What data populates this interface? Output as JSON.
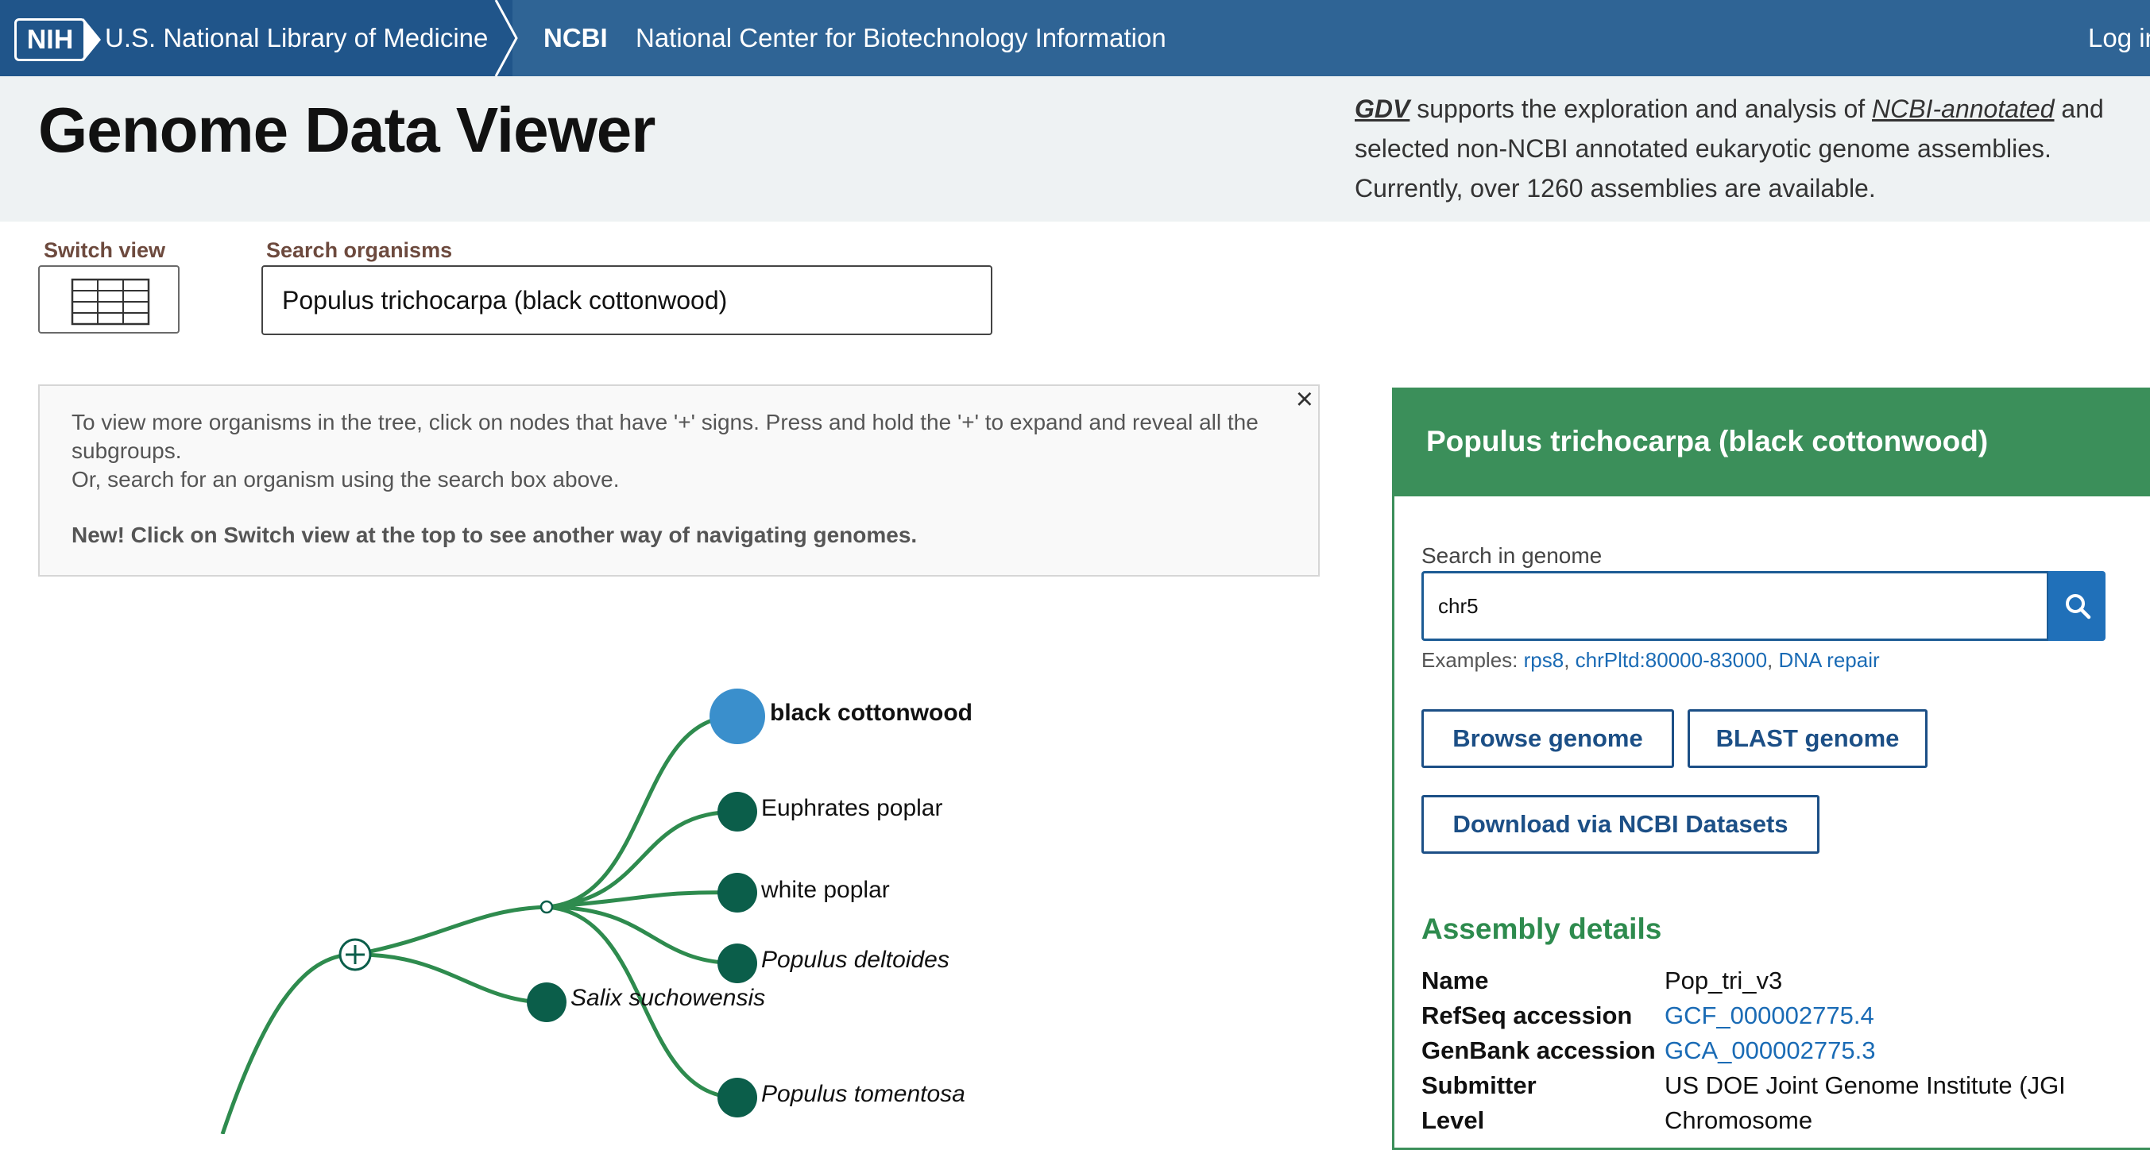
{
  "topbar": {
    "nih_badge": "NIH",
    "nih_name": "U.S. National Library of Medicine",
    "ncbi_short": "NCBI",
    "ncbi_long": "National Center for Biotechnology Information",
    "login": "Log in"
  },
  "header": {
    "title": "Genome Data Viewer",
    "intro_gdv": "GDV",
    "intro_part1": " supports the exploration and analysis of ",
    "intro_link": "NCBI-annotated",
    "intro_part2": " and selected non-NCBI annotated eukaryotic genome assemblies. Currently, over 1260 assemblies are available."
  },
  "controls": {
    "switch_view_label": "Switch view",
    "search_label": "Search organisms",
    "search_value": "Populus trichocarpa (black cottonwood)"
  },
  "info": {
    "line1": "To view more organisms in the tree, click on nodes that have '+' signs. Press and hold the '+' to expand and reveal all the subgroups.",
    "line2": "Or, search for an organism using the search box above.",
    "new_line": "New! Click on Switch view at the top to see another way of navigating genomes.",
    "close": "×"
  },
  "tree": {
    "leaves": [
      {
        "label": "black cottonwood",
        "style": "selected"
      },
      {
        "label": "Euphrates poplar",
        "style": "normal"
      },
      {
        "label": "white poplar",
        "style": "normal"
      },
      {
        "label": "Populus deltoides",
        "style": "italic"
      },
      {
        "label": "Salix suchowensis",
        "style": "italic"
      },
      {
        "label": "Populus tomentosa",
        "style": "italic"
      }
    ],
    "colors": {
      "branch": "#2e8b4e",
      "leaf": "#0b5e4a",
      "selected": "#3a8fcc"
    }
  },
  "panel": {
    "title": "Populus trichocarpa (black cottonwood)",
    "search_label": "Search in genome",
    "search_value": "chr5",
    "examples_label": "Examples: ",
    "examples": [
      "rps8",
      "chrPltd:80000-83000",
      "DNA repair"
    ],
    "buttons": {
      "browse": "Browse genome",
      "blast": "BLAST genome",
      "download": "Download via NCBI Datasets"
    },
    "assembly_title": "Assembly details",
    "details": [
      {
        "key": "Name",
        "value": "Pop_tri_v3",
        "link": false
      },
      {
        "key": "RefSeq accession",
        "value": "GCF_000002775.4",
        "link": true
      },
      {
        "key": "GenBank accession",
        "value": "GCA_000002775.3",
        "link": true
      },
      {
        "key": "Submitter",
        "value": "US DOE Joint Genome Institute (JGI",
        "link": false
      },
      {
        "key": "Level",
        "value": "Chromosome",
        "link": false
      }
    ],
    "colors": {
      "accent": "#3b8f5a",
      "button": "#1c4f86",
      "link": "#1a6bb5"
    }
  }
}
